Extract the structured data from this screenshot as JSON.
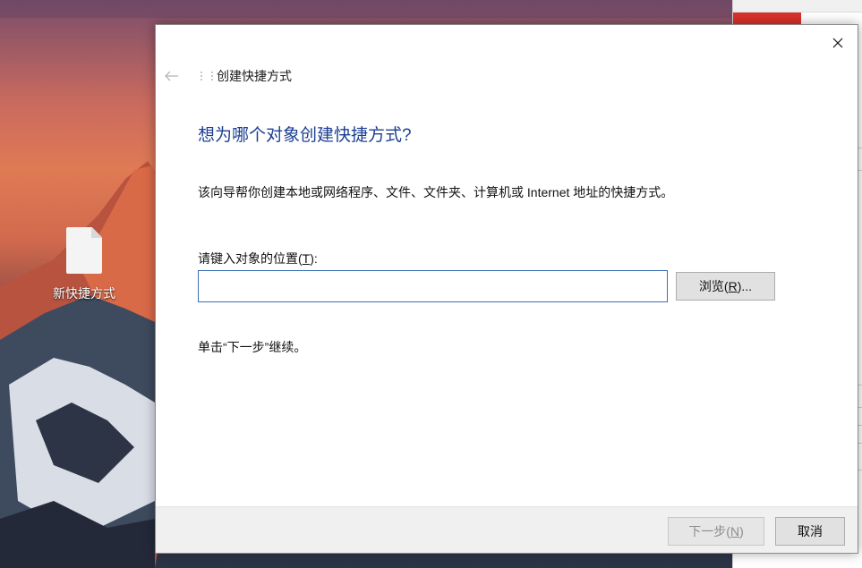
{
  "desktop": {
    "file_icon": {
      "icon": "file-icon",
      "label": "新快捷方式"
    }
  },
  "dialog": {
    "close_icon": "close-icon",
    "back_icon": "back-arrow-icon",
    "wizard_icon": "wizard-icon",
    "window_title": "创建快捷方式",
    "heading": "想为哪个对象创建快捷方式?",
    "description": "该向导帮你创建本地或网络程序、文件、文件夹、计算机或 Internet 地址的快捷方式。",
    "location_label": {
      "prefix": "请键入对象的位置(",
      "accelerator": "T",
      "suffix": "):"
    },
    "location_input": {
      "value": "",
      "placeholder": ""
    },
    "browse_button": {
      "prefix": "浏览(",
      "accelerator": "R",
      "suffix": ")..."
    },
    "hint": "单击“下一步”继续。",
    "footer": {
      "next_button": {
        "prefix": "下一步(",
        "accelerator": "N",
        "suffix": ")",
        "enabled": false
      },
      "cancel_button": "取消"
    }
  },
  "colors": {
    "heading": "#1c3f94",
    "input_border": "#3c6fb4",
    "footer_bg": "#f0f0f0",
    "button_bg": "#e1e1e1"
  }
}
